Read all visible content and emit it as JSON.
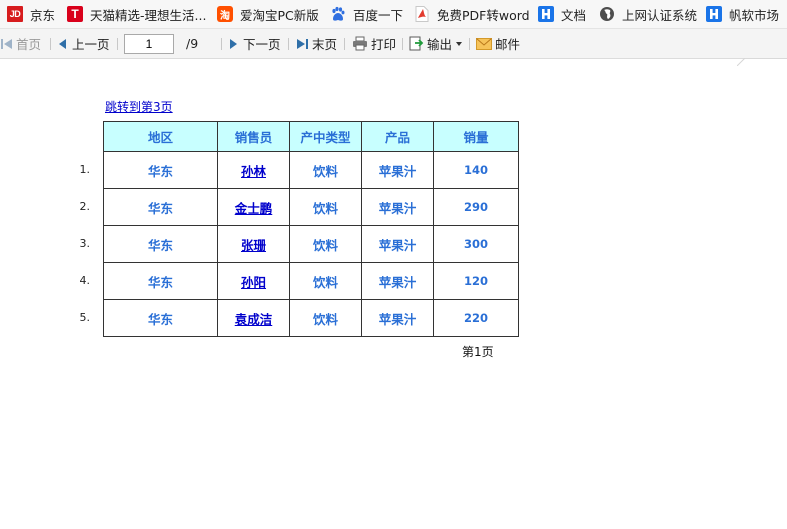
{
  "bookmarks": [
    {
      "label": "京东",
      "icon": "jd-icon"
    },
    {
      "label": "天猫精选-理想生活...",
      "icon": "tmall-icon"
    },
    {
      "label": "爱淘宝PC新版",
      "icon": "taobao-icon"
    },
    {
      "label": "百度一下",
      "icon": "baidu-paw-icon"
    },
    {
      "label": "免费PDF转word",
      "icon": "pdf-icon"
    },
    {
      "label": "文档",
      "icon": "fanruan-icon"
    },
    {
      "label": "上网认证系统",
      "icon": "globe-icon"
    },
    {
      "label": "帆软市场",
      "icon": "fanruan-icon"
    }
  ],
  "toolbar": {
    "first": "首页",
    "prev": "上一页",
    "page_value": "1",
    "total": "/9",
    "next": "下一页",
    "last": "末页",
    "print": "打印",
    "export": "输出",
    "mail": "邮件"
  },
  "report": {
    "jump_link": "跳转到第3页",
    "headers": [
      "地区",
      "销售员",
      "产中类型",
      "产品",
      "销量"
    ],
    "rows": [
      {
        "index": "1.",
        "region": "华东",
        "salesperson": "孙林",
        "type": "饮料",
        "product": "苹果汁",
        "sales": "140"
      },
      {
        "index": "2.",
        "region": "华东",
        "salesperson": "金士鹏",
        "type": "饮料",
        "product": "苹果汁",
        "sales": "290"
      },
      {
        "index": "3.",
        "region": "华东",
        "salesperson": "张珊",
        "type": "饮料",
        "product": "苹果汁",
        "sales": "300"
      },
      {
        "index": "4.",
        "region": "华东",
        "salesperson": "孙阳",
        "type": "饮料",
        "product": "苹果汁",
        "sales": "120"
      },
      {
        "index": "5.",
        "region": "华东",
        "salesperson": "袁成洁",
        "type": "饮料",
        "product": "苹果汁",
        "sales": "220"
      }
    ],
    "page_label": "第1页"
  },
  "colors": {
    "header_bg": "#c8ffff",
    "cell_text": "#2a6fd6",
    "link": "#0000cc"
  }
}
